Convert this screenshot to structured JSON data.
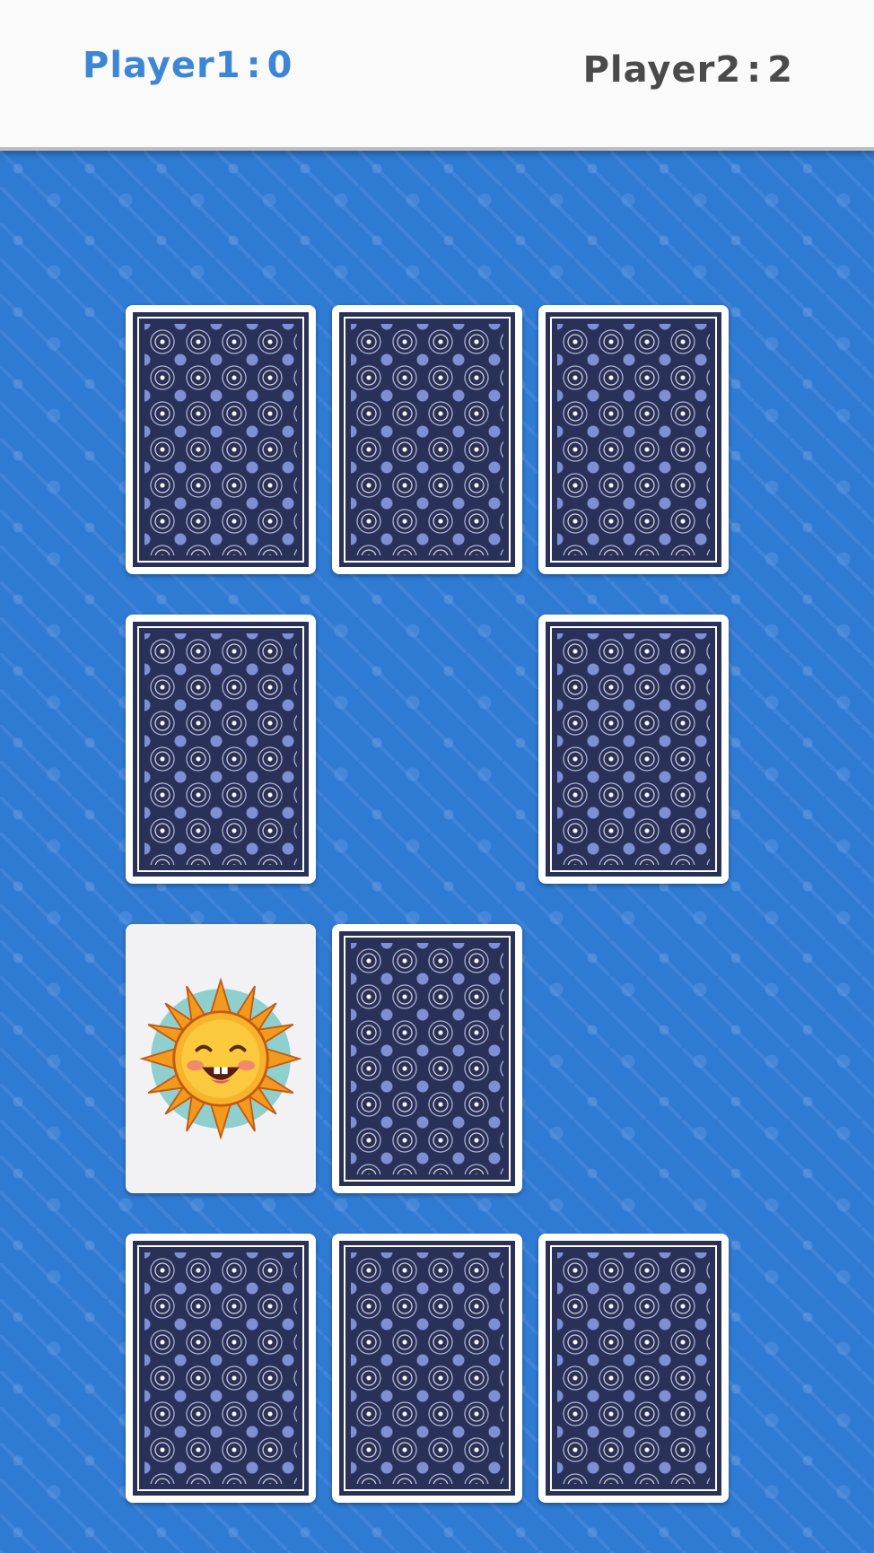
{
  "scoreboard": {
    "player1": {
      "name": "Player1",
      "score": "0",
      "color": "#3d86d6"
    },
    "player2": {
      "name": "Player2",
      "score": "2",
      "color": "#4a4a4a"
    },
    "separator": ":"
  },
  "board": {
    "background_color": "#2f7ad3",
    "card_back_color": "#2a3158",
    "cards": [
      {
        "state": "face-down"
      },
      {
        "state": "face-down"
      },
      {
        "state": "face-down"
      },
      {
        "state": "face-down"
      },
      {
        "state": "face-down"
      },
      {
        "state": "face-up",
        "image": "smiling-sun-icon"
      },
      {
        "state": "face-down"
      },
      {
        "state": "face-down"
      },
      {
        "state": "face-down"
      },
      {
        "state": "face-down"
      }
    ]
  }
}
